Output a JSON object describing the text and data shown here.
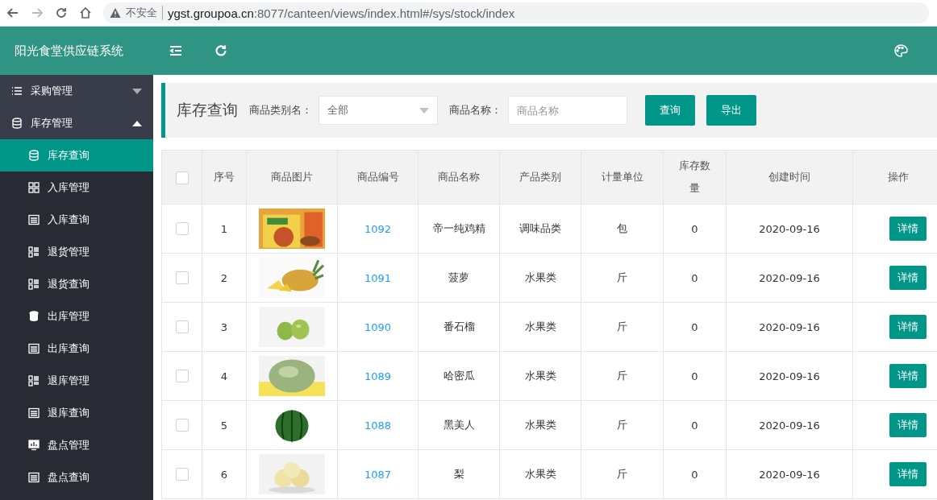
{
  "browser": {
    "security": "不安全",
    "url_host": "ygst.groupoa.cn",
    "url_path": ":8077/canteen/views/index.html#/sys/stock/index"
  },
  "header": {
    "title": "阳光食堂供应链系统"
  },
  "sidebar": {
    "groups": [
      {
        "label": "采购管理",
        "kind": "list",
        "expanded": false
      },
      {
        "label": "库存管理",
        "kind": "database",
        "expanded": true,
        "children": [
          {
            "label": "库存查询",
            "kind": "database",
            "selected": true
          },
          {
            "label": "入库管理",
            "kind": "grid",
            "selected": false
          },
          {
            "label": "入库查询",
            "kind": "table",
            "selected": false
          },
          {
            "label": "退货管理",
            "kind": "listgrid",
            "selected": false
          },
          {
            "label": "退货查询",
            "kind": "listgrid",
            "selected": false
          },
          {
            "label": "出库管理",
            "kind": "dbfill",
            "selected": false
          },
          {
            "label": "出库查询",
            "kind": "table",
            "selected": false
          },
          {
            "label": "退库管理",
            "kind": "listgrid",
            "selected": false
          },
          {
            "label": "退库查询",
            "kind": "table",
            "selected": false
          },
          {
            "label": "盘点管理",
            "kind": "monitor",
            "selected": false
          },
          {
            "label": "盘点查询",
            "kind": "table",
            "selected": false
          }
        ]
      }
    ]
  },
  "search": {
    "title": "库存查询",
    "category_label": "商品类别名：",
    "category_value": "全部",
    "name_label": "商品名称：",
    "name_placeholder": "商品名称",
    "buttons": [
      "查询",
      "导出"
    ]
  },
  "table": {
    "select_all": {
      "checked": false
    },
    "columns": [
      "序号",
      "商品图片",
      "商品编号",
      "商品名称",
      "产品类别",
      "计量单位",
      "库存数量",
      "创建时间",
      "操作"
    ],
    "rows": [
      {
        "checked": false,
        "no": "1",
        "code": "1092",
        "name": "帝一纯鸡精",
        "category": "调味品类",
        "unit": "包",
        "qty": "0",
        "created": "2020-09-16",
        "action": "详情"
      },
      {
        "checked": false,
        "no": "2",
        "code": "1091",
        "name": "菠萝",
        "category": "水果类",
        "unit": "斤",
        "qty": "0",
        "created": "2020-09-16",
        "action": "详情"
      },
      {
        "checked": false,
        "no": "3",
        "code": "1090",
        "name": "番石榴",
        "category": "水果类",
        "unit": "斤",
        "qty": "0",
        "created": "2020-09-16",
        "action": "详情"
      },
      {
        "checked": false,
        "no": "4",
        "code": "1089",
        "name": "哈密瓜",
        "category": "水果类",
        "unit": "斤",
        "qty": "0",
        "created": "2020-09-16",
        "action": "详情"
      },
      {
        "checked": false,
        "no": "5",
        "code": "1088",
        "name": "黑美人",
        "category": "水果类",
        "unit": "斤",
        "qty": "0",
        "created": "2020-09-16",
        "action": "详情"
      },
      {
        "checked": false,
        "no": "6",
        "code": "1087",
        "name": "梨",
        "category": "水果类",
        "unit": "斤",
        "qty": "0",
        "created": "2020-09-16",
        "action": "详情"
      }
    ]
  }
}
